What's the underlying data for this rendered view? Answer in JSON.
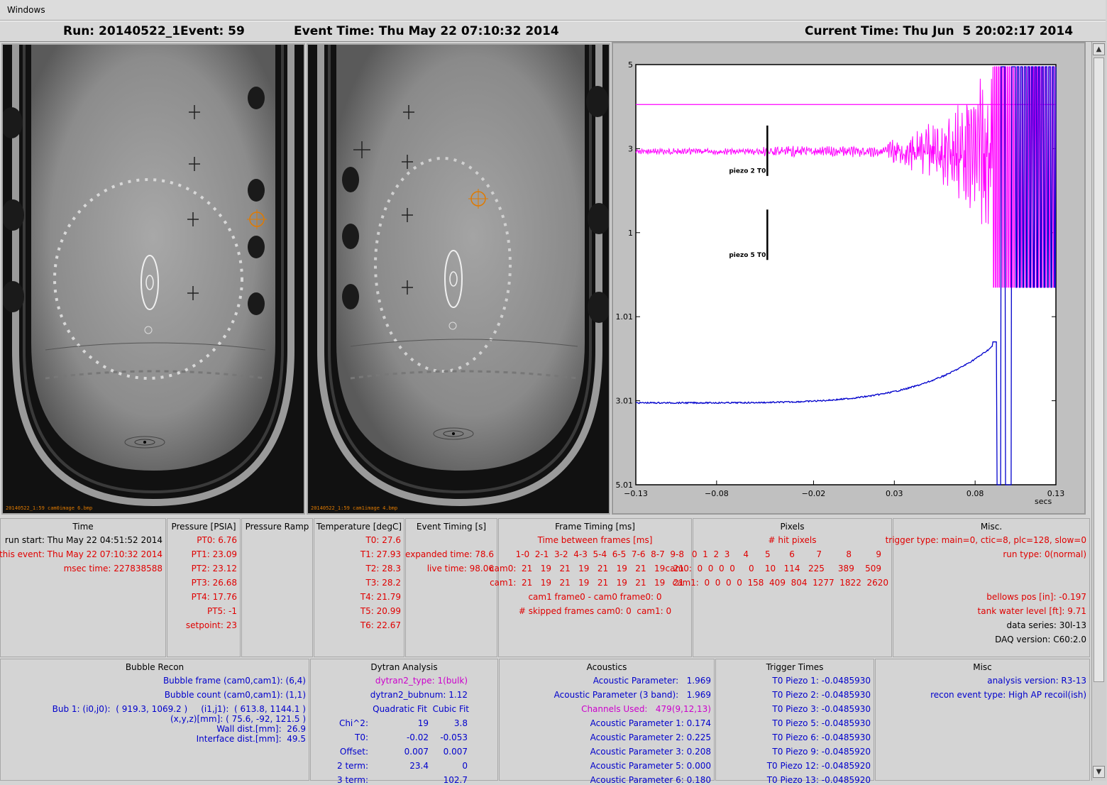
{
  "menubar": {
    "windows": "Windows"
  },
  "header": {
    "run": "Run: 20140522_1",
    "event": "Event: 59",
    "event_time": "Event Time: Thu May 22 07:10:32 2014",
    "current_time": "Current Time: Thu Jun  5 20:02:17 2014"
  },
  "cameras": {
    "cam0_label": "20140522_1:59 cam0image 6.bmp",
    "cam1_label": "20140522_1:59 cam1image 4.bmp"
  },
  "colors": {
    "magenta": "#ff00ff",
    "blue": "#0000cc",
    "red": "#e00000",
    "orange": "#e07a00"
  },
  "chart_data": {
    "type": "line",
    "xlabel": "secs",
    "x_ticks": [
      "-0.13",
      "-0.08",
      "-0.02",
      "0.03",
      "0.08",
      "0.13"
    ],
    "y_ticks": [
      "5",
      "3",
      "1",
      "1.01",
      "3.01",
      "5.01"
    ],
    "xlim": [
      -0.13,
      0.13
    ],
    "annotations": [
      "piezo 2 T0",
      "piezo 5 T0"
    ],
    "series": [
      {
        "color": "#ff00ff",
        "description_values": {
          "baseline": 4.05,
          "quiet_level": 2.9
        }
      },
      {
        "color": "#0000cc",
        "description_values": {
          "baseline": -3.01
        }
      }
    ]
  },
  "panels": {
    "time": {
      "title": "Time",
      "run_start": "run start: Thu May 22 04:51:52 2014",
      "this_event": "this event: Thu May 22 07:10:32 2014",
      "msec_time": "msec time: 227838588"
    },
    "pressure": {
      "title": "Pressure [PSIA]",
      "values": [
        "PT0: 6.76",
        "PT1: 23.09",
        "PT2: 23.12",
        "PT3: 26.68",
        "PT4: 17.76",
        "PT5: -1",
        "setpoint: 23"
      ]
    },
    "pressure_ramp": {
      "title": "Pressure Ramp"
    },
    "temperature": {
      "title": "Temperature [degC]",
      "values": [
        "T0: 27.6",
        "T1: 27.93",
        "T2: 28.3",
        "T3: 28.2",
        "T4: 21.79",
        "T5: 20.99",
        "T6: 22.67"
      ]
    },
    "event_timing": {
      "title": "Event Timing [s]",
      "expanded": "expanded time: 78.6",
      "live": "live time: 98.06"
    },
    "frame_timing": {
      "title": "Frame Timing [ms]",
      "subtitle": "Time between frames [ms]",
      "header": "1-0  2-1  3-2  4-3  5-4  6-5  7-6  8-7  9-8",
      "cam0": "cam0:  21   19   21   19   21   19   21   19   21",
      "cam1": "cam1:  21   19   21   19   21   19   21   19   21",
      "diff": "cam1 frame0 - cam0 frame0: 0",
      "skipped": "# skipped frames cam0: 0  cam1: 0"
    },
    "pixels": {
      "title": "Pixels",
      "subtitle": "# hit pixels",
      "header": "0  1  2  3     4      5       6        7         8         9",
      "cam0": "cam0:  0  0  0  0     0    10   114   225     389    509",
      "cam1": "cam1:  0  0  0  0  158  409  804  1277  1822  2620"
    },
    "misc_top": {
      "title": "Misc.",
      "trigger": "trigger type: main=0, ctic=8, plc=128, slow=0",
      "run_type": "run type: 0(normal)",
      "bellows": "bellows pos [in]: -0.197",
      "tank": "tank water level [ft]: 9.71",
      "series": "data series: 30l-13",
      "daq": "DAQ version: C60:2.0"
    },
    "bubble": {
      "title": "Bubble Recon",
      "frame": "Bubble frame (cam0,cam1): (6,4)",
      "count": "Bubble count (cam0,cam1): (1,1)",
      "bub1": "Bub 1: (i0,j0):  ( 919.3, 1069.2 )     (i1,j1):  ( 613.8, 1144.1 )",
      "xyz": "(x,y,z)[mm]: ( 75.6, -92, 121.5 )",
      "wall": "Wall dist.[mm]:  26.9",
      "interface": "Interface dist.[mm]:  49.5"
    },
    "dytran": {
      "title": "Dytran Analysis",
      "type": "dytran2_type: 1(bulk)",
      "bubnum": "dytran2_bubnum: 1.12",
      "fit_header": "Quadratic Fit  Cubic Fit",
      "rows": [
        {
          "label": "Chi^2:",
          "q": "19",
          "c": "3.8"
        },
        {
          "label": "T0:",
          "q": "-0.02",
          "c": "-0.053"
        },
        {
          "label": "Offset:",
          "q": "0.007",
          "c": "0.007"
        },
        {
          "label": "2 term:",
          "q": "23.4",
          "c": "0"
        },
        {
          "label": "3 term:",
          "q": "",
          "c": "102.7"
        }
      ]
    },
    "acoustics": {
      "title": "Acoustics",
      "ap": "Acoustic Parameter:   1.969",
      "ap3": "Acoustic Parameter (3 band):   1.969",
      "channels": "Channels Used:   479(9,12,13)",
      "ap1": "Acoustic Parameter 1: 0.174",
      "ap2": "Acoustic Parameter 2: 0.225",
      "ap3b": "Acoustic Parameter 3: 0.208",
      "ap5": "Acoustic Parameter 5: 0.000",
      "ap6": "Acoustic Parameter 6: 0.180"
    },
    "trigger": {
      "title": "Trigger Times",
      "values": [
        "T0 Piezo 1: -0.0485930",
        "T0 Piezo 2: -0.0485930",
        "T0 Piezo 3: -0.0485930",
        "T0 Piezo 5: -0.0485930",
        "T0 Piezo 6: -0.0485930",
        "T0 Piezo 9: -0.0485920",
        "T0 Piezo 12: -0.0485920",
        "T0 Piezo 13: -0.0485920"
      ]
    },
    "misc_bottom": {
      "title": "Misc",
      "analysis": "analysis version: R3-13",
      "recon": "recon event type: High AP recoil(ish)"
    }
  }
}
